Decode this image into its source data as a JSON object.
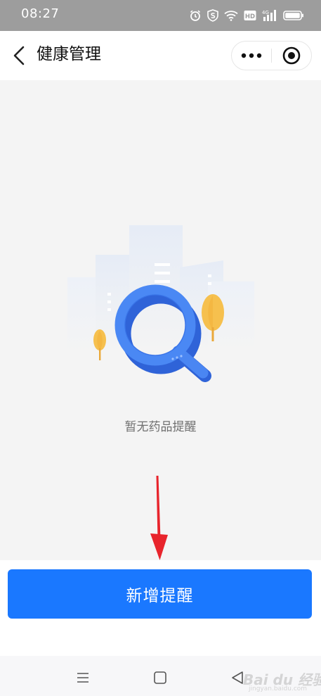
{
  "status_bar": {
    "time": "08:27",
    "icons": [
      "alarm-icon",
      "shield-s-icon",
      "wifi-icon",
      "hd-icon",
      "signal-4g-icon",
      "battery-icon"
    ],
    "hd_label": "HD",
    "network_label": "4G"
  },
  "nav": {
    "title": "健康管理",
    "back_icon": "chevron-left-icon",
    "more_icon": "more-dots-icon",
    "close_icon": "target-circle-icon"
  },
  "empty_state": {
    "illustration": "magnifier-buildings-illustration",
    "text": "暂无药品提醒"
  },
  "annotation": {
    "arrow_color": "#e8242c"
  },
  "action": {
    "add_reminder_label": "新增提醒",
    "button_color": "#1a78ff"
  },
  "system_nav": {
    "menu_icon": "menu-lines-icon",
    "home_icon": "square-home-icon",
    "back_icon": "triangle-back-icon"
  },
  "watermark": {
    "logo_text": "Bai du 经验",
    "url": "jingyan.baidu.com"
  }
}
